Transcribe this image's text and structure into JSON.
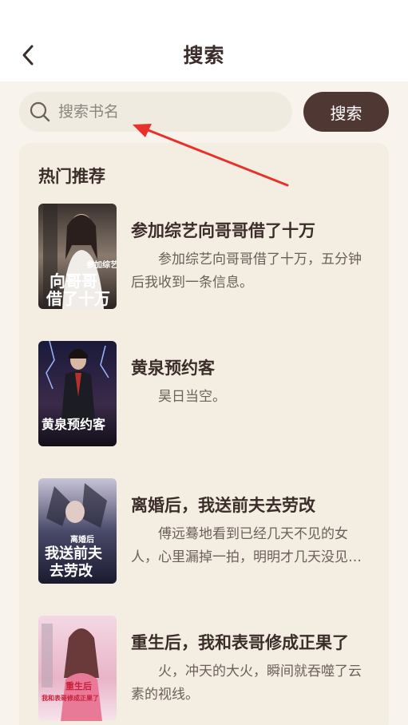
{
  "header": {
    "title": "搜索",
    "back_icon": "chevron-left-icon"
  },
  "search": {
    "placeholder": "搜索书名",
    "value": "",
    "button_label": "搜索",
    "icon": "search-icon"
  },
  "colors": {
    "background": "#f8f4ed",
    "card": "#f3ede2",
    "accent": "#4f3734",
    "title_text": "#3b2e2a",
    "desc_text": "#6b605a",
    "annotation_arrow": "#e8312a"
  },
  "hot": {
    "title": "热门推荐",
    "books": [
      {
        "title": "参加综艺向哥哥借了十万",
        "desc": "参加综艺向哥哥借了十万，五分钟后我收到一条信息。",
        "cover_text": [
          "参加综艺",
          "向哥哥",
          "借了十万"
        ]
      },
      {
        "title": "黄泉预约客",
        "desc": "昊日当空。",
        "cover_text": [
          "黄泉预约客"
        ]
      },
      {
        "title": "离婚后，我送前夫去劳改",
        "desc": "傅远蓦地看到已经几天不见的女人，心里漏掉一拍，明明才几天没见，却像过了很久很久。",
        "cover_text": [
          "离婚后",
          "我送前夫",
          "去劳改"
        ]
      },
      {
        "title": "重生后，我和表哥修成正果了",
        "desc": "火，冲天的大火，瞬间就吞噬了云素的视线。",
        "cover_text": [
          "重生后",
          "我和表哥修成正果了"
        ]
      }
    ]
  }
}
